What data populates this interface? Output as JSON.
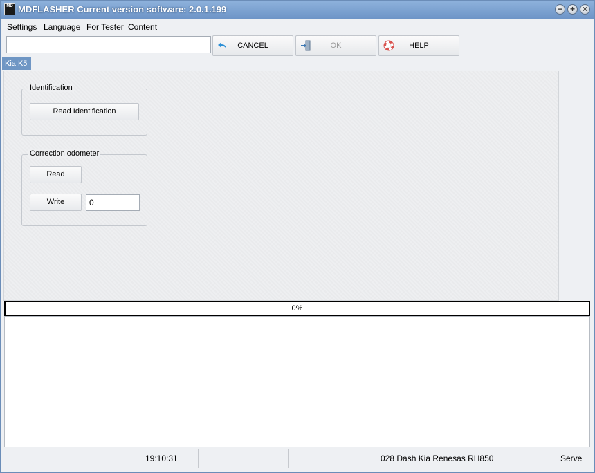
{
  "window": {
    "app_icon_text": "MD",
    "title": "MDFLASHER  Current version software: 2.0.1.199"
  },
  "menu": {
    "items": [
      "Settings",
      "Language",
      "For Tester",
      "Content"
    ]
  },
  "toolbar": {
    "input_value": "",
    "cancel_label": "CANCEL",
    "ok_label": "OK",
    "help_label": "HELP",
    "ok_enabled": false
  },
  "tab": {
    "label": "Kia K5"
  },
  "identification": {
    "title": "Identification",
    "read_button": "Read Identification"
  },
  "odometer": {
    "title": "Correction odometer",
    "read_button": "Read",
    "write_button": "Write",
    "value": "0"
  },
  "progress": {
    "percent": 0,
    "text": "0%"
  },
  "status": {
    "cell1": "",
    "time": "19:10:31",
    "cell3": "",
    "cell4": "",
    "device": "028 Dash Kia Renesas RH850",
    "server": "Serve"
  },
  "colors": {
    "titlebar": "#7ba2d2",
    "tab": "#6f96c4",
    "progress_fill": "#5fa8e8"
  }
}
